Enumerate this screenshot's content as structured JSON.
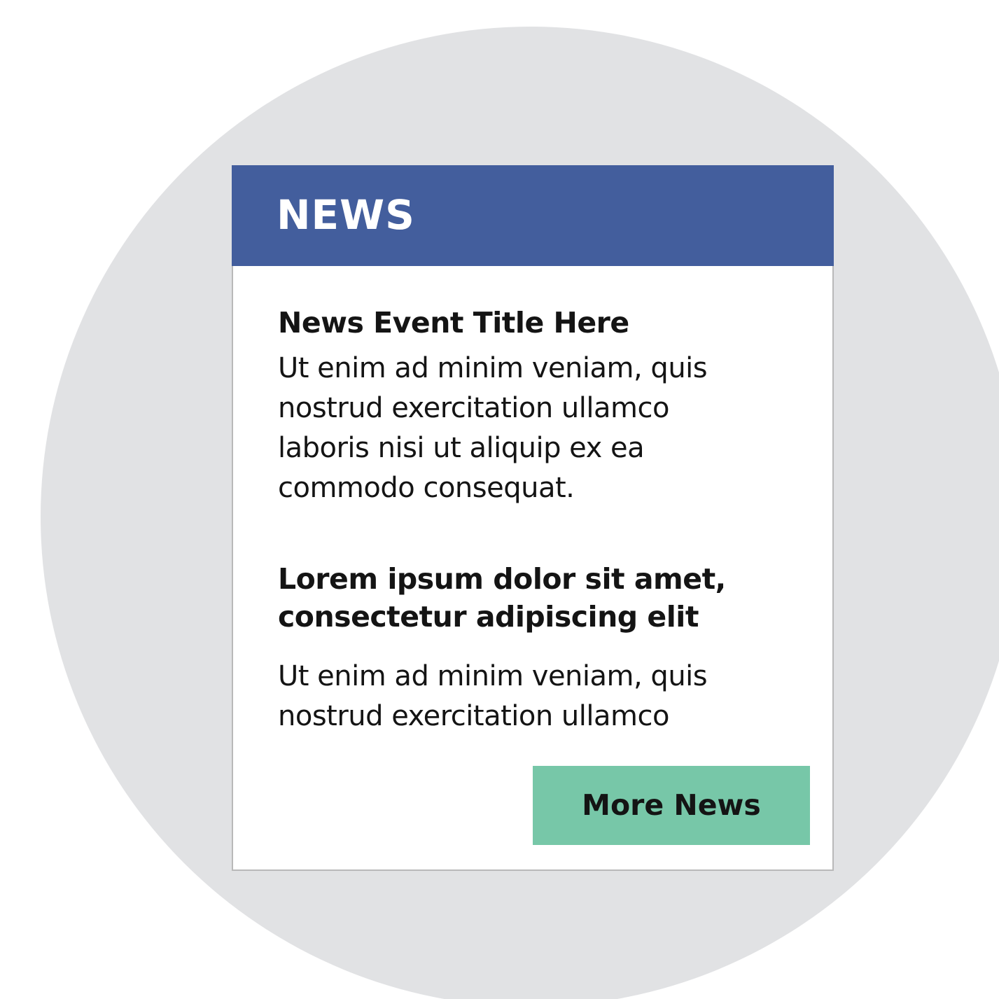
{
  "widget": {
    "header": {
      "title": "NEWS"
    },
    "items": [
      {
        "title": "News Event Title Here",
        "body": "Ut enim ad minim veniam, quis nostrud exercitation ullamco laboris nisi ut aliquip ex ea commodo consequat."
      },
      {
        "title": "Lorem ipsum dolor sit amet, consectetur adipiscing elit",
        "body": "Ut enim ad minim veniam, quis nostrud exercitation ullamco"
      }
    ],
    "more_button_label": "More News"
  },
  "colors": {
    "background_circle": "#e1e2e4",
    "header": "#435e9d",
    "button": "#77c7a8",
    "card_border": "#b9b9b9",
    "text": "#141414"
  }
}
